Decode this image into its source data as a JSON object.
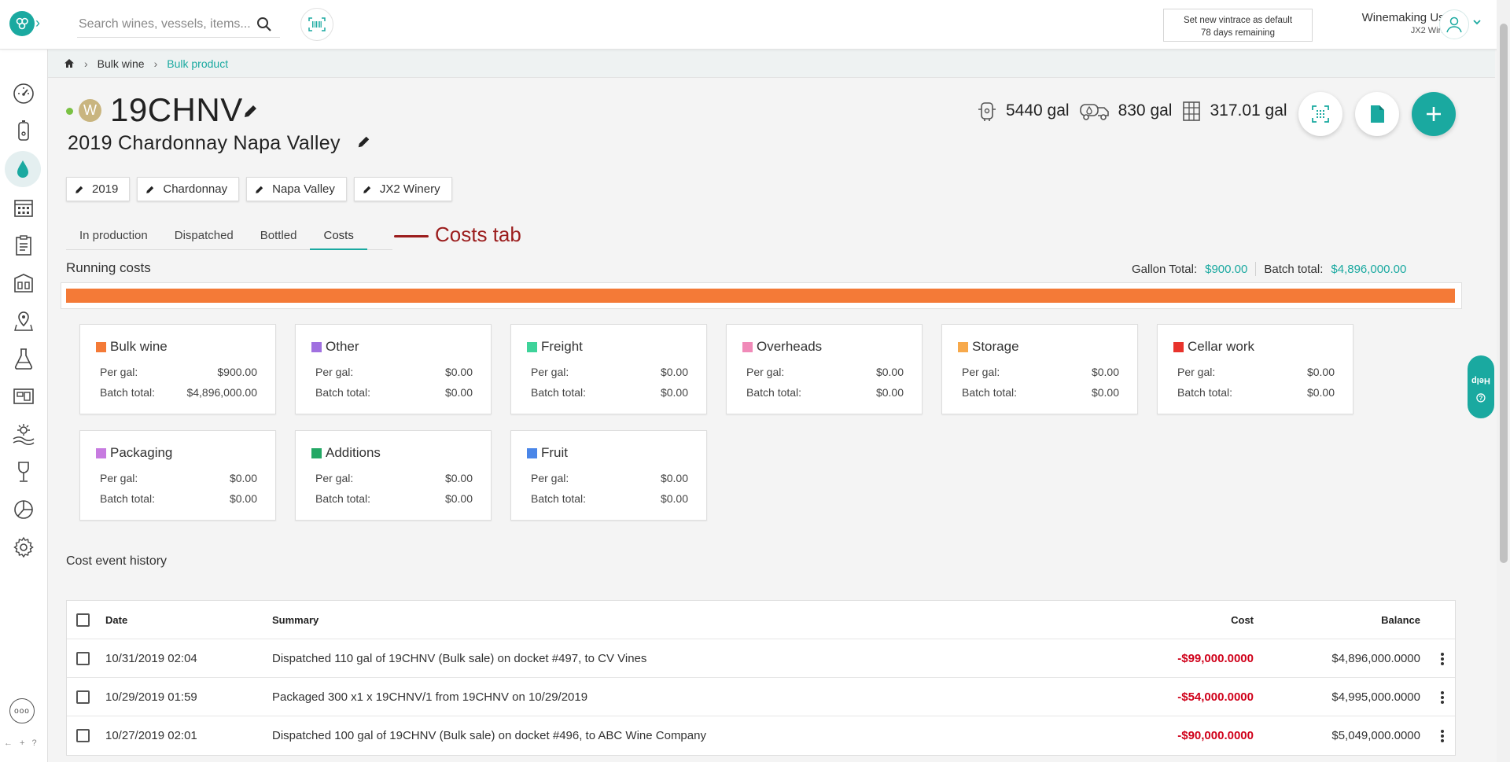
{
  "header": {
    "search_placeholder": "Search wines, vessels, items...",
    "vintrace_line1": "Set new vintrace as default",
    "vintrace_line2": "78 days remaining",
    "user_name": "Winemaking User",
    "user_org": "JX2 Winery"
  },
  "sidebar": {
    "items": [
      "dashboard-icon",
      "vessel-icon",
      "bulk-wine-icon",
      "calendar-icon",
      "work-order-icon",
      "winery-icon",
      "location-icon",
      "lab-icon",
      "stock-icon",
      "vineyard-icon",
      "wine-glass-icon",
      "reports-icon",
      "settings-icon"
    ],
    "active_index": 2,
    "more_label": "ooo",
    "keys_label": "← + ?"
  },
  "breadcrumb": {
    "items": [
      "Bulk wine",
      "Bulk product"
    ]
  },
  "product": {
    "badge": "W",
    "code": "19CHNV",
    "description": "2019 Chardonnay Napa Valley",
    "stats": [
      {
        "icon": "tank-icon",
        "value": "5440 gal"
      },
      {
        "icon": "truck-icon",
        "value": "830 gal"
      },
      {
        "icon": "bottles-icon",
        "value": "317.01 gal"
      }
    ],
    "chips": [
      "2019",
      "Chardonnay",
      "Napa Valley",
      "JX2 Winery"
    ]
  },
  "tabs": [
    "In production",
    "Dispatched",
    "Bottled",
    "Costs"
  ],
  "active_tab": 3,
  "annotation": "Costs tab",
  "running_costs": {
    "title": "Running costs",
    "gallon_total_label": "Gallon Total:",
    "gallon_total": "$900.00",
    "batch_total_label": "Batch total:",
    "batch_total": "$4,896,000.00",
    "bar_fill_fraction": 1.0,
    "bar_color": "#f47a37"
  },
  "cost_cards": [
    {
      "title": "Bulk wine",
      "color": "#f47a37",
      "per_gal": "$900.00",
      "batch_total": "$4,896,000.00"
    },
    {
      "title": "Other",
      "color": "#a070e0",
      "per_gal": "$0.00",
      "batch_total": "$0.00"
    },
    {
      "title": "Freight",
      "color": "#3ed39a",
      "per_gal": "$0.00",
      "batch_total": "$0.00"
    },
    {
      "title": "Overheads",
      "color": "#f08ab8",
      "per_gal": "$0.00",
      "batch_total": "$0.00"
    },
    {
      "title": "Storage",
      "color": "#f7a94b",
      "per_gal": "$0.00",
      "batch_total": "$0.00"
    },
    {
      "title": "Cellar work",
      "color": "#e8332c",
      "per_gal": "$0.00",
      "batch_total": "$0.00"
    },
    {
      "title": "Packaging",
      "color": "#c77be0",
      "per_gal": "$0.00",
      "batch_total": "$0.00"
    },
    {
      "title": "Additions",
      "color": "#23a865",
      "per_gal": "$0.00",
      "batch_total": "$0.00"
    },
    {
      "title": "Fruit",
      "color": "#4a86e8",
      "per_gal": "$0.00",
      "batch_total": "$0.00"
    }
  ],
  "card_labels": {
    "per_gal": "Per gal:",
    "batch_total": "Batch total:"
  },
  "history": {
    "title": "Cost event history",
    "columns": {
      "date": "Date",
      "summary": "Summary",
      "cost": "Cost",
      "balance": "Balance"
    },
    "rows": [
      {
        "date": "10/31/2019 02:04",
        "summary": "Dispatched 110 gal of 19CHNV (Bulk sale) on docket #497, to CV Vines",
        "cost": "-$99,000.0000",
        "balance": "$4,896,000.0000"
      },
      {
        "date": "10/29/2019 01:59",
        "summary": "Packaged 300 x1 x 19CHNV/1 from 19CHNV on 10/29/2019",
        "cost": "-$54,000.0000",
        "balance": "$4,995,000.0000"
      },
      {
        "date": "10/27/2019 02:01",
        "summary": "Dispatched 100 gal of 19CHNV (Bulk sale) on docket #496, to ABC Wine Company",
        "cost": "-$90,000.0000",
        "balance": "$5,049,000.0000"
      }
    ]
  },
  "help_label": "Help",
  "colors": {
    "accent": "#1aa9a0",
    "annotation": "#9b1c1c",
    "negative": "#d0021b"
  }
}
